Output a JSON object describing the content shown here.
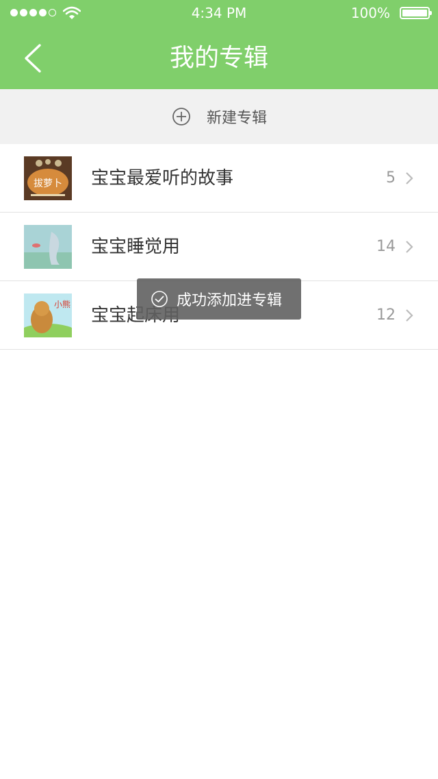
{
  "status_bar": {
    "time": "4:34 PM",
    "battery_percent": "100%",
    "battery_level": 1.0,
    "signal_bars_filled": 4,
    "signal_bars_total": 5
  },
  "nav": {
    "title": "我的专辑",
    "back_icon": "chevron-left-icon"
  },
  "new_album": {
    "label": "新建专辑",
    "icon": "plus-circle-icon"
  },
  "albums": [
    {
      "title": "宝宝最爱听的故事",
      "count": "5",
      "cover_text": "拔萝卜"
    },
    {
      "title": "宝宝睡觉用",
      "count": "14"
    },
    {
      "title": "宝宝起床用",
      "count": "12",
      "cover_text": "小熊"
    }
  ],
  "toast": {
    "message": "成功添加进专辑",
    "icon": "check-circle-icon"
  },
  "colors": {
    "brand_green": "#80cf6b",
    "toast_bg": "#606060",
    "divider": "#e2e2e2",
    "section_bg": "#f1f1f1"
  }
}
